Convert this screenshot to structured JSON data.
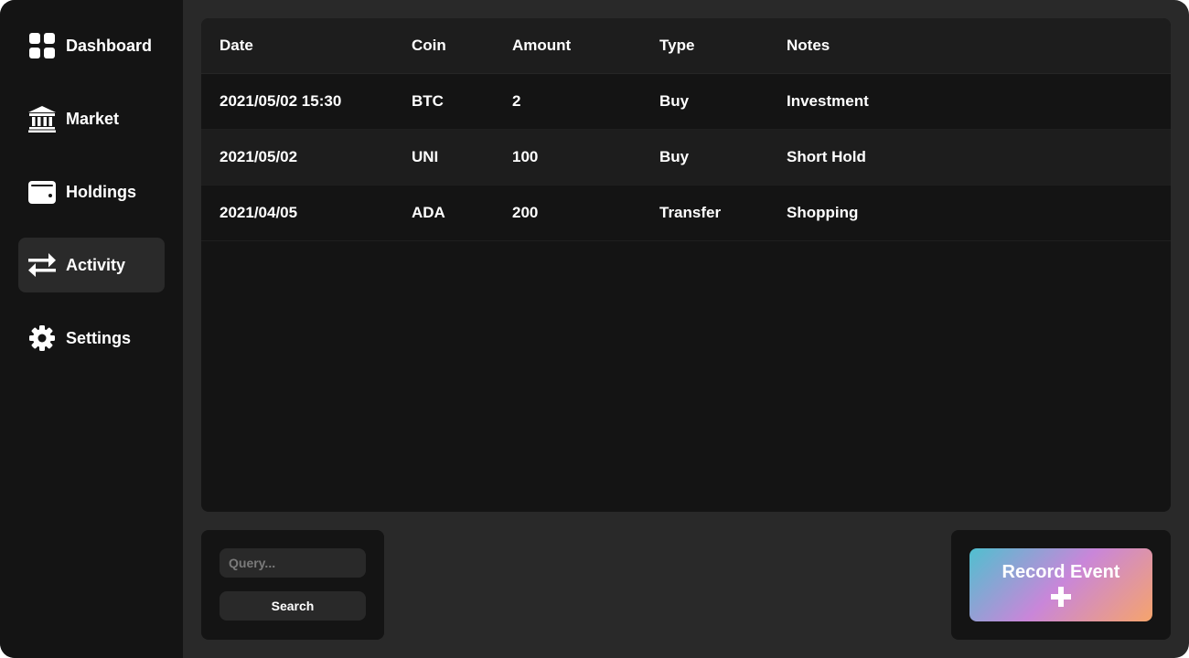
{
  "sidebar": {
    "items": [
      {
        "label": "Dashboard",
        "icon": "dashboard-grid-icon",
        "active": false
      },
      {
        "label": "Market",
        "icon": "bank-building-icon",
        "active": false
      },
      {
        "label": "Holdings",
        "icon": "wallet-icon",
        "active": false
      },
      {
        "label": "Activity",
        "icon": "transfer-arrows-icon",
        "active": true
      },
      {
        "label": "Settings",
        "icon": "gear-icon",
        "active": false
      }
    ]
  },
  "table": {
    "headers": [
      "Date",
      "Coin",
      "Amount",
      "Type",
      "Notes"
    ],
    "rows": [
      [
        "2021/05/02 15:30",
        "BTC",
        "2",
        "Buy",
        "Investment"
      ],
      [
        "2021/05/02",
        "UNI",
        "100",
        "Buy",
        "Short Hold"
      ],
      [
        "2021/04/05",
        "ADA",
        "200",
        "Transfer",
        "Shopping"
      ]
    ]
  },
  "search": {
    "placeholder": "Query...",
    "button_label": "Search"
  },
  "record": {
    "label": "Record Event",
    "icon": "plus-icon"
  },
  "colors": {
    "background": "#292929",
    "panel": "#141414",
    "gradient": [
      "#4fc0cf",
      "#c986d9",
      "#f6a46b"
    ]
  }
}
